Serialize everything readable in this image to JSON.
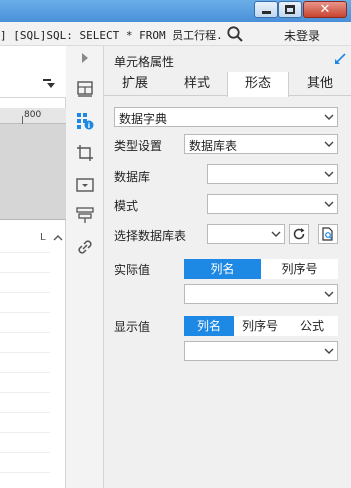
{
  "window": {
    "controls": [
      "minimize",
      "maximize",
      "close"
    ]
  },
  "infobar": {
    "sql_text": "] [SQL]SQL: SELECT * FROM 员工行程...",
    "login_label": "未登录"
  },
  "designer": {
    "ruler_tick": "800",
    "column_marker": "L"
  },
  "rail": {
    "icons": [
      "layout-icon",
      "cell-properties-icon",
      "crop-icon",
      "widget-icon",
      "stack-icon",
      "link-icon"
    ]
  },
  "panel": {
    "title": "单元格属性",
    "tabs": [
      {
        "label": "扩展",
        "active": false
      },
      {
        "label": "样式",
        "active": false
      },
      {
        "label": "形态",
        "active": true
      },
      {
        "label": "其他",
        "active": false
      }
    ],
    "form": {
      "dict_type": "数据字典",
      "type_setting_label": "类型设置",
      "type_setting_value": "数据库表",
      "database_label": "数据库",
      "database_value": "",
      "schema_label": "模式",
      "schema_value": "",
      "table_label": "选择数据库表",
      "table_value": "",
      "actual_label": "实际值",
      "actual_options": [
        "列名",
        "列序号"
      ],
      "actual_selected": "列名",
      "actual_value": "",
      "display_label": "显示值",
      "display_options": [
        "列名",
        "列序号",
        "公式"
      ],
      "display_selected": "列名",
      "display_value": ""
    }
  },
  "colors": {
    "accent": "#1e88e5",
    "titlebar": "#4a90d9",
    "panel_bg": "#f0f0f0"
  }
}
